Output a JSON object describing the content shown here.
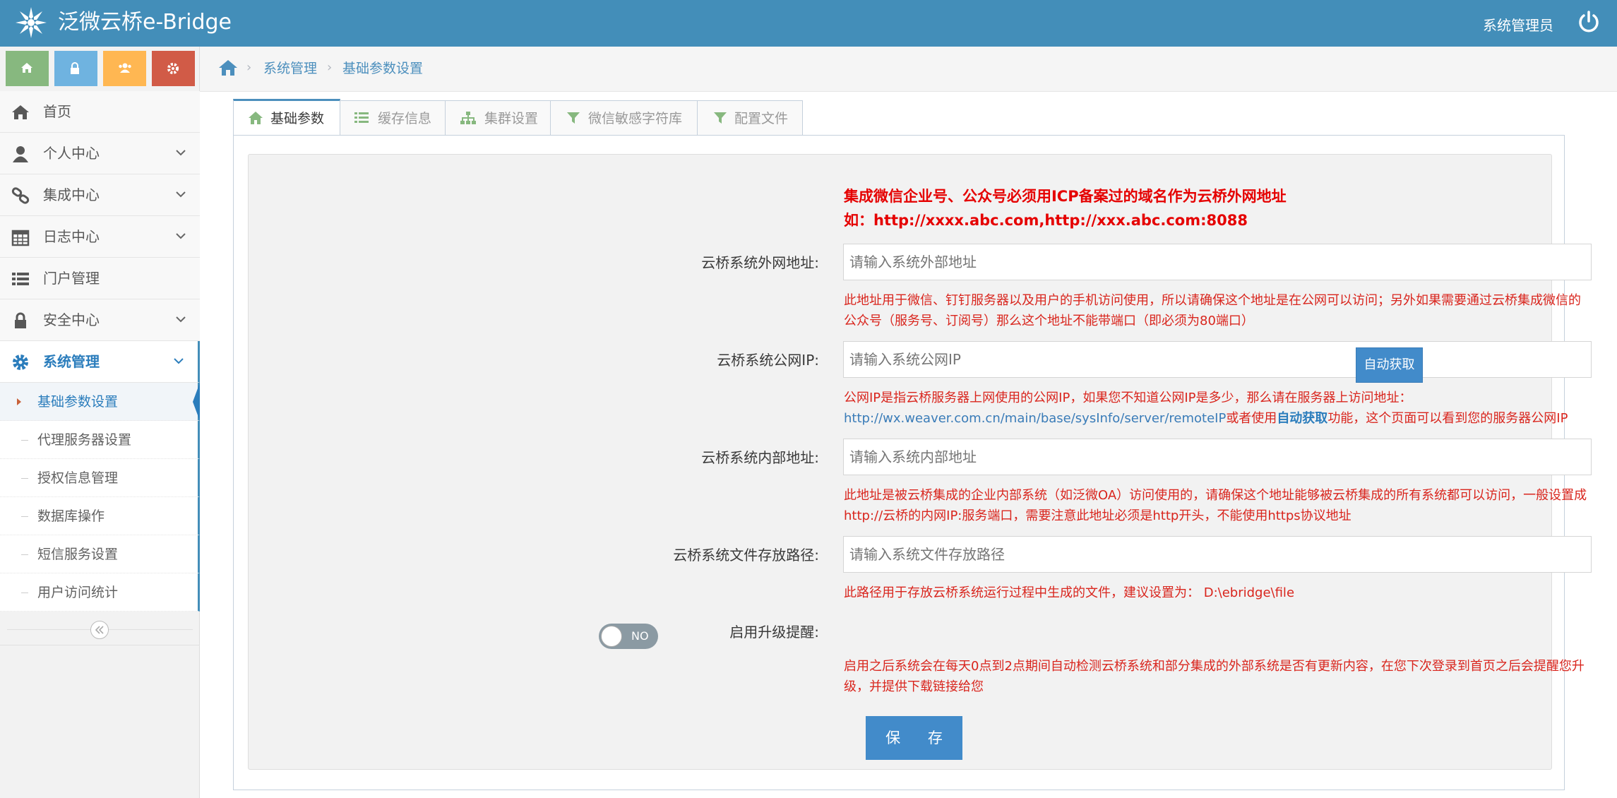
{
  "header": {
    "brand": "泛微云桥e-Bridge",
    "user": "系统管理员"
  },
  "sidebar": {
    "shortcut_colors": [
      "#87b87f",
      "#6fb3e0",
      "#ffb752",
      "#d15b47"
    ],
    "items": [
      {
        "label": "首页",
        "icon": "home-icon"
      },
      {
        "label": "个人中心",
        "icon": "user-icon"
      },
      {
        "label": "集成中心",
        "icon": "link-icon"
      },
      {
        "label": "日志中心",
        "icon": "calendar-icon"
      },
      {
        "label": "门户管理",
        "icon": "list-icon"
      },
      {
        "label": "安全中心",
        "icon": "lock-icon"
      },
      {
        "label": "系统管理",
        "icon": "gear-icon"
      }
    ],
    "sub_items": [
      {
        "label": "基础参数设置"
      },
      {
        "label": "代理服务器设置"
      },
      {
        "label": "授权信息管理"
      },
      {
        "label": "数据库操作"
      },
      {
        "label": "短信服务设置"
      },
      {
        "label": "用户访问统计"
      }
    ]
  },
  "breadcrumb": {
    "level1": "系统管理",
    "level2": "基础参数设置"
  },
  "tabs": [
    {
      "label": "基础参数",
      "icon": "home-icon"
    },
    {
      "label": "缓存信息",
      "icon": "list-icon"
    },
    {
      "label": "集群设置",
      "icon": "sitemap-icon"
    },
    {
      "label": "微信敏感字符库",
      "icon": "filter-icon"
    },
    {
      "label": "配置文件",
      "icon": "filter-icon"
    }
  ],
  "form": {
    "alert_line1": "集成微信企业号、公众号必须用ICP备案过的域名作为云桥外网地址",
    "alert_line2": "如：http://xxxx.abc.com,http://xxx.abc.com:8088",
    "external_address": {
      "label": "云桥系统外网地址:",
      "placeholder": "请输入系统外部地址",
      "help": "此地址用于微信、钉钉服务器以及用户的手机访问使用，所以请确保这个地址是在公网可以访问；另外如果需要通过云桥集成微信的公众号（服务号、订阅号）那么这个地址不能带端口（即必须为80端口）"
    },
    "public_ip": {
      "label": "云桥系统公网IP:",
      "placeholder": "请输入系统公网IP",
      "auto_button": "自动获取",
      "help_line1": "公网IP是指云桥服务器上网使用的公网IP，如果您不知道公网IP是多少，那么请在服务器上访问地址：",
      "help_link": "http://wx.weaver.com.cn/main/base/sysInfo/server/remoteIP",
      "help_mid": "或者使用",
      "help_bold": "自动获取",
      "help_end": "功能，这个页面可以看到您的服务器公网IP"
    },
    "internal_address": {
      "label": "云桥系统内部地址:",
      "placeholder": "请输入系统内部地址",
      "help": "此地址是被云桥集成的企业内部系统（如泛微OA）访问使用的，请确保这个地址能够被云桥集成的所有系统都可以访问，一般设置成 http://云桥的内网IP:服务端口，需要注意此地址必须是http开头，不能使用https协议地址"
    },
    "file_path": {
      "label": "云桥系统文件存放路径:",
      "placeholder": "请输入系统文件存放路径",
      "help": "此路径用于存放云桥系统运行过程中生成的文件，建议设置为： D:\\ebridge\\file"
    },
    "upgrade_reminder": {
      "label": "启用升级提醒:",
      "toggle_text": "NO",
      "help": "启用之后系统会在每天0点到2点期间自动检测云桥系统和部分集成的外部系统是否有更新内容，在您下次登录到首页之后会提醒您升级，并提供下载链接给您"
    },
    "save_button": "保 存"
  }
}
